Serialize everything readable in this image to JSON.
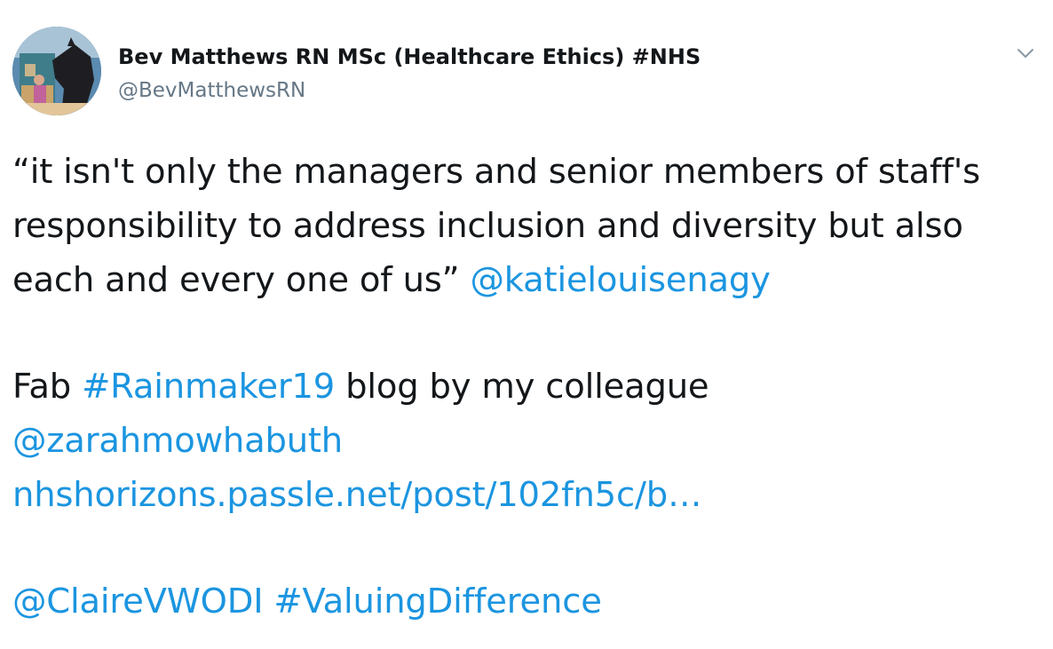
{
  "author": {
    "display_name": "Bev Matthews RN MSc (Healthcare Ethics) #NHS",
    "handle": "@BevMatthewsRN",
    "avatar_icon": "profile-photo-with-horse"
  },
  "menu": {
    "caret_icon": "chevron-down-icon"
  },
  "tweet": {
    "p1_line1": "“it isn't only the managers and senior members of staff's",
    "p1_line2": "responsibility to address inclusion and diversity but also",
    "p1_line3_text": "each and every one of us” ",
    "p1_line3_mention": "@katielouisenagy",
    "p2_line1_pre": "Fab ",
    "p2_line1_hashtag": "#Rainmaker19",
    "p2_line1_post": " blog by my colleague",
    "p2_line2_mention": "@zarahmowhabuth",
    "p2_line3_link": "nhshorizons.passle.net/post/102fn5c/b…",
    "p3_mention": "@ClaireVWODI",
    "p3_space": " ",
    "p3_hashtag": "#ValuingDifference"
  },
  "colors": {
    "text": "#14171a",
    "secondary": "#657786",
    "link": "#1b95e0"
  }
}
